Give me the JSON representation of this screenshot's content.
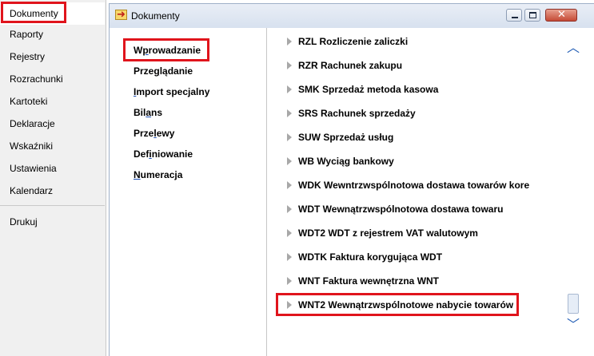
{
  "leftnav": {
    "items": [
      {
        "label": "Dokumenty",
        "active": true
      },
      {
        "label": "Raporty"
      },
      {
        "label": "Rejestry"
      },
      {
        "label": "Rozrachunki"
      },
      {
        "label": "Kartoteki"
      },
      {
        "label": "Deklaracje"
      },
      {
        "label": "Wskaźniki"
      },
      {
        "label": "Ustawienia"
      },
      {
        "label": "Kalendarz"
      },
      {
        "label": "Drukuj"
      }
    ]
  },
  "window": {
    "title": "Dokumenty",
    "buttons": {
      "minimize": "minimize",
      "maximize": "maximize",
      "close": "close"
    }
  },
  "menu": {
    "items": [
      {
        "pre": "W",
        "acc": "p",
        "post": "rowadzanie",
        "selected": true
      },
      {
        "pre": "Prze",
        "acc": "g",
        "post": "lądanie"
      },
      {
        "pre": "",
        "acc": "I",
        "post": "mport specjalny"
      },
      {
        "pre": "Bil",
        "acc": "a",
        "post": "ns"
      },
      {
        "pre": "Prze",
        "acc": "l",
        "post": "ewy"
      },
      {
        "pre": "Def",
        "acc": "i",
        "post": "niowanie"
      },
      {
        "pre": "",
        "acc": "N",
        "post": "umeracja"
      }
    ]
  },
  "documents": {
    "items": [
      {
        "label": "RZL Rozliczenie zaliczki"
      },
      {
        "label": "RZR Rachunek zakupu"
      },
      {
        "label": "SMK Sprzedaż metoda kasowa"
      },
      {
        "label": "SRS Rachunek sprzedaży"
      },
      {
        "label": "SUW Sprzedaż usług"
      },
      {
        "label": "WB Wyciąg bankowy"
      },
      {
        "label": "WDK Wewntrzwspólnotowa dostawa towarów kore"
      },
      {
        "label": "WDT Wewnątrzwspólnotowa dostawa towaru"
      },
      {
        "label": "WDT2 WDT z rejestrem VAT walutowym"
      },
      {
        "label": "WDTK Faktura korygująca WDT"
      },
      {
        "label": "WNT Faktura wewnętrzna WNT"
      },
      {
        "label": "WNT2 Wewnątrzwspólnotowe nabycie towarów",
        "highlighted": true
      }
    ]
  },
  "scrollbar": {
    "up_icon": "chevron-up-icon",
    "down_icon": "chevron-down-icon",
    "thumb_start": 0.92,
    "thumb_end": 1.0
  },
  "colors": {
    "highlight": "#e0141c",
    "accent": "#1f5bb4"
  }
}
